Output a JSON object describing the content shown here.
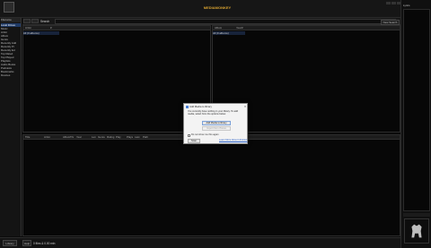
{
  "window": {
    "title": "MEDIAMONKEY"
  },
  "icons": {
    "logo": "app-logo-icon",
    "minimize": "minimize-icon",
    "maximize": "maximize-icon",
    "close": "close-icon",
    "info": "info-icon"
  },
  "toolbar": {
    "search_label": "Search"
  },
  "right_panel": {
    "header": "Lyrics",
    "new_search": "New Search"
  },
  "sidebar": {
    "header": "Filename",
    "items": [
      "Local Drives",
      "Music",
      "Artist",
      "Album",
      "Genre",
      "Recently Add",
      "Recently Pl",
      "Recently Ed",
      "Top Rated",
      "Top Played",
      "Playlists",
      "Audio Books",
      "Podcasts",
      "Bookmarks",
      "Devices"
    ]
  },
  "panes": {
    "artist": {
      "headers": [
        "Artist",
        "#"
      ],
      "first_row": "All (0 albums)"
    },
    "album": {
      "headers": [
        "Album",
        "Year",
        "#"
      ],
      "first_row": "All (0 albums)"
    },
    "tracks": {
      "headers": [
        "Title",
        "Artist",
        "Album",
        "Trk",
        "Year",
        "Len",
        "Genre",
        "Rating",
        "Play",
        "Plays",
        "Last",
        "Path"
      ]
    }
  },
  "statusbar": {
    "button1": "Library",
    "button2": "Help",
    "text": "0 files & 0.00 min"
  },
  "dialog": {
    "title": "Add Media to library",
    "body": "You currently have nothing in your library. To add media, select from the options below.",
    "add_button": "Add Media to library",
    "import_button": "Import from iTunes",
    "checkbox_label": "Do not show me this again",
    "scan_button": "Scan",
    "learn_link": "Learn More About Libraries"
  }
}
